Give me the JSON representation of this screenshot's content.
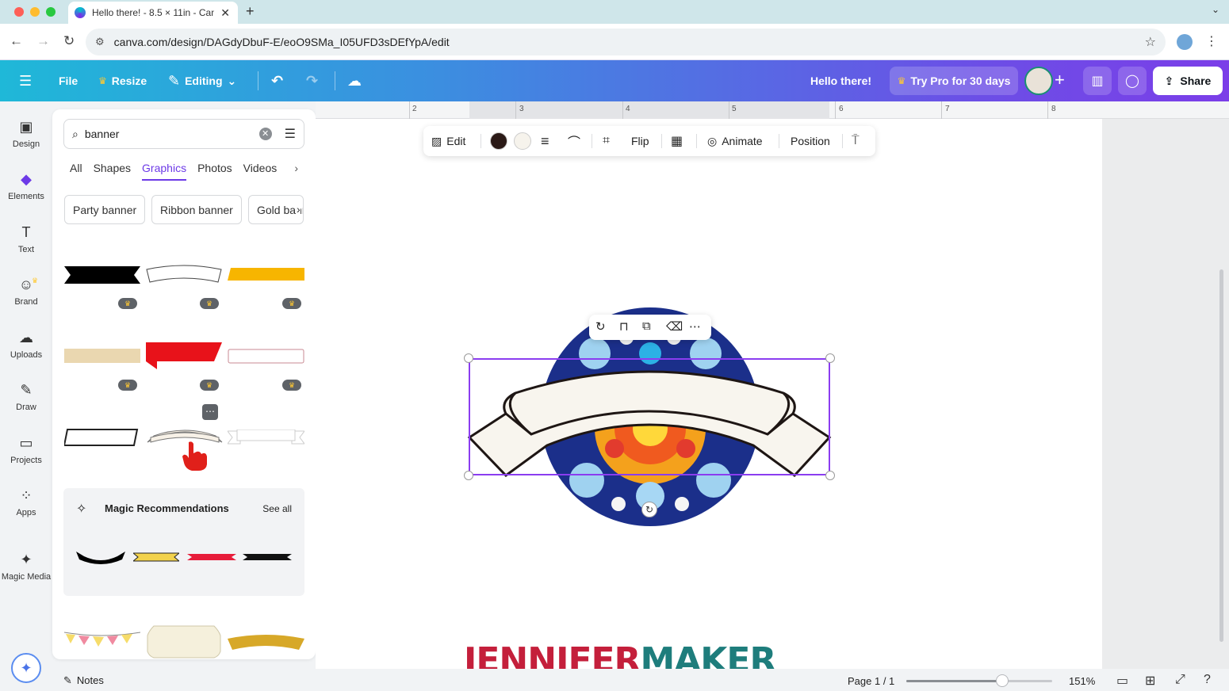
{
  "browser": {
    "tab_title": "Hello there! - 8.5 × 11in - Can",
    "url": "canva.com/design/DAGdyDbuF-E/eoO9SMa_I05UFD3sDEfYpA/edit"
  },
  "header": {
    "file": "File",
    "resize": "Resize",
    "editing": "Editing",
    "doc_title": "Hello there!",
    "try_pro": "Try Pro for 30 days",
    "share": "Share"
  },
  "rail": [
    {
      "label": "Design",
      "icon": "▣"
    },
    {
      "label": "Elements",
      "icon": "◆"
    },
    {
      "label": "Text",
      "icon": "T"
    },
    {
      "label": "Brand",
      "icon": "☺"
    },
    {
      "label": "Uploads",
      "icon": "☁"
    },
    {
      "label": "Draw",
      "icon": "✎"
    },
    {
      "label": "Projects",
      "icon": "▭"
    },
    {
      "label": "Apps",
      "icon": "⁘"
    },
    {
      "label": "Magic Media",
      "icon": "✦"
    }
  ],
  "panel": {
    "search_value": "banner",
    "tabs": [
      "All",
      "Shapes",
      "Graphics",
      "Photos",
      "Videos"
    ],
    "chips": [
      "Party banner",
      "Ribbon banner",
      "Gold banner"
    ],
    "magic_title": "Magic Recommendations",
    "see_all": "See all"
  },
  "ruler": [
    "2",
    "3",
    "4",
    "5",
    "6",
    "7",
    "8"
  ],
  "toolbar": {
    "edit": "Edit",
    "flip": "Flip",
    "animate": "Animate",
    "position": "Position",
    "colors": [
      "#2b1a17",
      "#f6f3ec"
    ]
  },
  "logo": {
    "part1": "JENNIFER",
    "part2": "MAKER"
  },
  "bottom": {
    "notes": "Notes",
    "page": "Page 1 / 1",
    "zoom": "151%",
    "zoom_level": 0.66
  }
}
